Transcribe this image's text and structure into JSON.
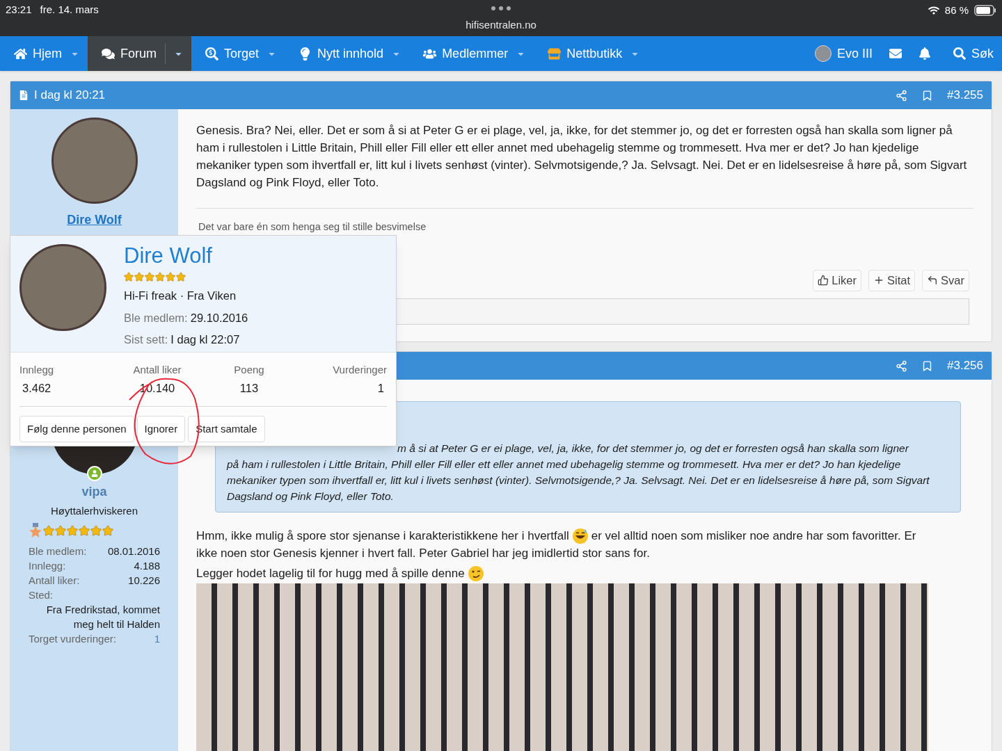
{
  "status_bar": {
    "time": "23:21",
    "date": "fre. 14. mars",
    "url": "hifisentralen.no",
    "battery": "86 %"
  },
  "nav": {
    "items": [
      {
        "label": "Hjem",
        "selected": false
      },
      {
        "label": "Forum",
        "selected": true
      },
      {
        "label": "Torget",
        "selected": false
      },
      {
        "label": "Nytt innhold",
        "selected": false
      },
      {
        "label": "Medlemmer",
        "selected": false
      },
      {
        "label": "Nettbutikk",
        "selected": false
      }
    ],
    "user": "Evo III",
    "search": "Søk"
  },
  "posts": [
    {
      "date": "I dag kl 20:21",
      "number": "#3.255",
      "author": {
        "name": "Dire Wolf"
      },
      "text": "Genesis. Bra? Nei, eller. Det er som å si at Peter G er ei plage, vel, ja, ikke, for det stemmer jo, og det er forresten også han skalla som ligner på ham i rullestolen i Little Britain, Phill eller Fill eller ett eller annet med ubehagelig stemme og trommesett. Hva mer er det? Jo han kjedelige mekaniker typen som ihvertfall er, litt kul i livets senhøst (vinter). Selvmotsigende,? Ja. Selvsagt. Nei. Det er en lidelsesreise å høre på, som Sigvart Dagsland og Pink Floyd, eller Toto.",
      "signature": "Det var bare én som henga seg til stille besvimelse",
      "actions": [
        {
          "kind": "like",
          "label": "Liker"
        },
        {
          "kind": "quote",
          "label": "Sitat"
        },
        {
          "kind": "reply",
          "label": "Svar"
        }
      ]
    },
    {
      "number": "#3.256",
      "author": {
        "name": "vipa",
        "title": "Høyttalerhviskeren",
        "stars": 6,
        "stats": [
          {
            "label": "Ble medlem:",
            "value": "08.01.2016"
          },
          {
            "label": "Innlegg:",
            "value": "4.188"
          },
          {
            "label": "Antall liker:",
            "value": "10.226"
          },
          {
            "label": "Sted:",
            "value": "Fra Fredrikstad, kommet meg helt til Halden",
            "kind": "stacked"
          },
          {
            "label": "Torget vurderinger:",
            "value": "1",
            "kind": "link"
          }
        ]
      },
      "quote": {
        "partial_line": "m å si at Peter G er ei plage, vel, ja, ikke, for det stemmer jo, og det er forresten også han skalla som ligner",
        "text": "på ham i rullestolen i Little Britain, Phill eller Fill eller ett eller annet med ubehagelig stemme og trommesett. Hva mer er det? Jo han kjedelige mekaniker typen som ihvertfall er, litt kul i livets senhøst (vinter). Selvmotsigende,? Ja. Selvsagt. Nei. Det er en lidelsesreise å høre på, som Sigvart Dagsland og Pink Floyd, eller Toto."
      },
      "paragraphs": [
        [
          {
            "kind": "text",
            "text": "Hmm, ikke mulig å spore stor sjenanse i karakteristikkene her i hvertfall"
          },
          {
            "kind": "sweat-smile"
          },
          {
            "kind": "text",
            "text": "er vel alltid noen som misliker noe andre har som favoritter. Er"
          },
          {
            "kind": "text",
            "text": "ikke noen stor Genesis kjenner i hvert fall. Peter Gabriel har jeg imidlertid stor sans for."
          }
        ],
        [
          {
            "kind": "text",
            "text": "Legger hodet lagelig til for hugg med å spille denne"
          },
          {
            "kind": "wink"
          }
        ]
      ]
    }
  ],
  "popup": {
    "name": "Dire Wolf",
    "stars": 6,
    "title_line": "Hi-Fi freak · Fra Viken",
    "joined_label": "Ble medlem:",
    "joined": "29.10.2016",
    "seen_label": "Sist sett:",
    "seen": "I dag kl 22:07",
    "stats": [
      {
        "label": "Innlegg",
        "value": "3.462"
      },
      {
        "label": "Antall liker",
        "value": "10.140"
      },
      {
        "label": "Poeng",
        "value": "113"
      },
      {
        "label": "Vurderinger",
        "value": "1"
      }
    ],
    "buttons": [
      "Følg denne personen",
      "Ignorer",
      "Start samtale"
    ]
  }
}
